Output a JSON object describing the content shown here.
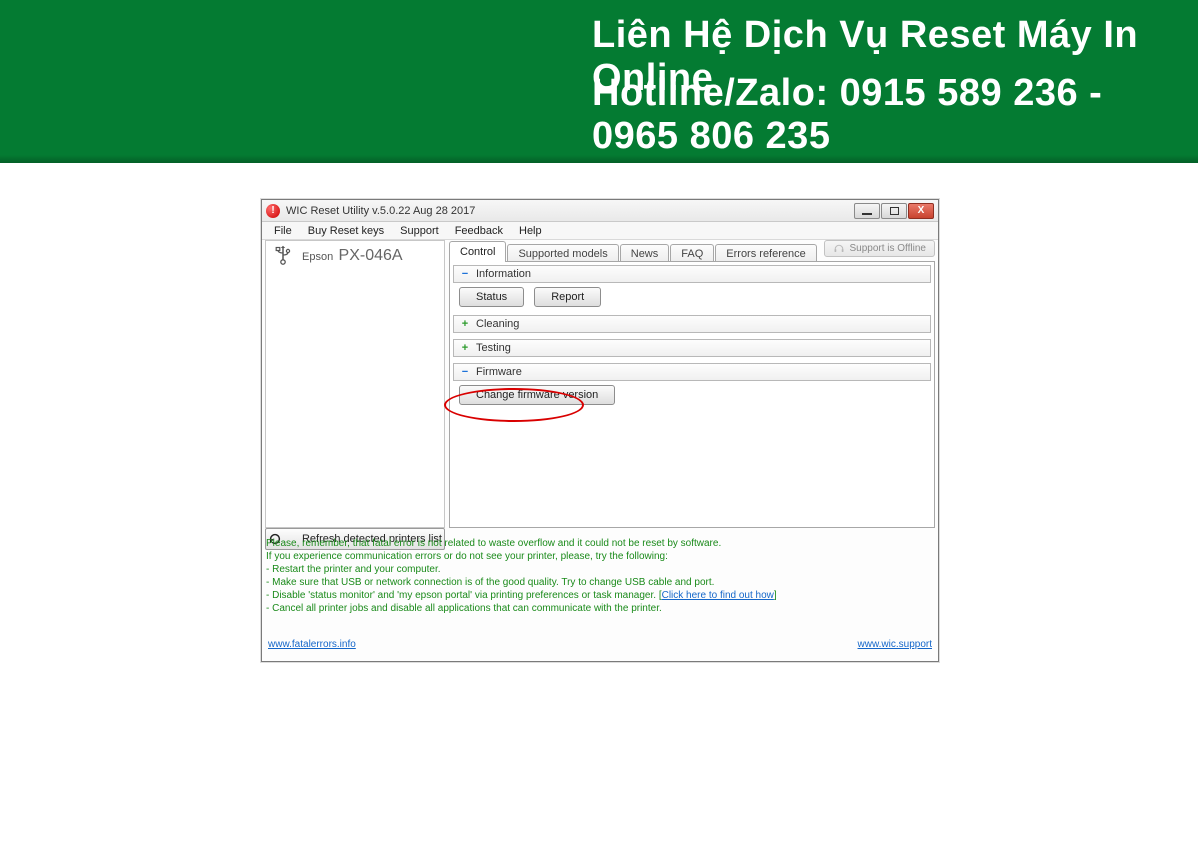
{
  "banner": {
    "line1": "Liên Hệ Dịch Vụ Reset Máy In Online",
    "line2": "Hotline/Zalo: 0915 589 236 - 0965 806 235"
  },
  "window": {
    "title": "WIC Reset Utility v.5.0.22 Aug 28 2017",
    "controls": {
      "minimize": "—",
      "maximize": "▢",
      "close": "X"
    }
  },
  "menus": [
    "File",
    "Buy Reset keys",
    "Support",
    "Feedback",
    "Help"
  ],
  "sidebar": {
    "printer_brand": "Epson",
    "printer_model": "PX-046A",
    "refresh_label": "Refresh detected printers list"
  },
  "tabs": [
    "Control",
    "Supported models",
    "News",
    "FAQ",
    "Errors reference"
  ],
  "support_badge": "Support is Offline",
  "groups": {
    "information": {
      "title": "Information",
      "expanded": true
    },
    "cleaning": {
      "title": "Cleaning",
      "expanded": false
    },
    "testing": {
      "title": "Testing",
      "expanded": false
    },
    "firmware": {
      "title": "Firmware",
      "expanded": true
    }
  },
  "buttons": {
    "status": "Status",
    "report": "Report",
    "change_firmware": "Change firmware version"
  },
  "help": {
    "l1": "Please, remember, that fatal error is not related to waste overflow and it could not be reset by software.",
    "l2": "If you experience communication errors or do not see your printer, please, try the following:",
    "l3": "- Restart the printer and your computer.",
    "l4": "- Make sure that USB or network connection is of the good quality. Try to change USB cable and port.",
    "l5a": "- Disable 'status monitor' and 'my epson portal' via printing preferences or task manager. [",
    "l5_link": "Click here to find out how",
    "l5b": "]",
    "l6": "- Cancel all printer jobs and disable all applications that can communicate with the printer."
  },
  "footer": {
    "left": "www.fatalerrors.info",
    "right": "www.wic.support"
  }
}
